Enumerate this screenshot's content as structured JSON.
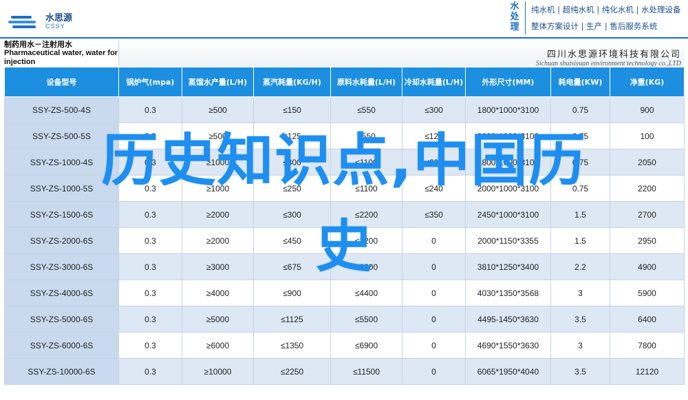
{
  "header": {
    "logo_cn": "水思源",
    "logo_en": "CSSY",
    "slogan_vertical": "水处理",
    "slogan_line1": "纯水机 | 超纯水机 | 纯化水机 | 水处理设备",
    "slogan_line2": "整体方案设计 | 生产 | 售后服务系统"
  },
  "title": {
    "cn": "制药用水－注射用水",
    "en": "Pharmaceutical water, water for injection",
    "company_cn": "四川水思源环境科技有限公司",
    "company_en": "Sichuan shuisiyuan environment technology co.,LTD"
  },
  "table": {
    "columns": [
      "设备型号",
      "锅炉气(mpa)",
      "蒸馏水产量(L/H)",
      "蒸汽耗量(KG/H)",
      "原料水耗量(L/H)",
      "冷却水耗量(L/H)",
      "外形尺寸(MM)",
      "耗电量(KW)",
      "净重(KG)"
    ],
    "rows": [
      [
        "SSY-ZS-500-4S",
        "0.3",
        "≥500",
        "≤150",
        "≤550",
        "≤300",
        "1800*1000*3100",
        "0.75",
        "900"
      ],
      [
        "SSY-ZS-500-5S",
        "0.3",
        "≥500",
        "≤125",
        "≤550",
        "≤120",
        "2000*1000*3100",
        "0.75",
        "100"
      ],
      [
        "SSY-ZS-1000-4S",
        "0.3",
        "≥1000",
        "≤300",
        "≤1100",
        "≤600",
        "1800*1000*3100",
        "0.75",
        "2050"
      ],
      [
        "SSY-ZS-1000-5S",
        "0.3",
        "≥1000",
        "≤250",
        "≤1100",
        "≤240",
        "2000*1000*3100",
        "0.75",
        "2200"
      ],
      [
        "SSY-ZS-1500-6S",
        "0.3",
        "≥2000",
        "≤300",
        "≤2200",
        "≤350",
        "2450*1000*3100",
        "1.5",
        "2700"
      ],
      [
        "SSY-ZS-2000-6S",
        "0.3",
        "≥2000",
        "≤450",
        "≤2200",
        "0",
        "2000*1150*3355",
        "1.5",
        "2950"
      ],
      [
        "SSY-ZS-3000-6S",
        "0.3",
        "≥3000",
        "≤675",
        "≤3300",
        "0",
        "3810*1250*3400",
        "2.2",
        "4900"
      ],
      [
        "SSY-ZS-4000-6S",
        "0.3",
        "≥4000",
        "≤900",
        "≤4400",
        "0",
        "4030*1350*3568",
        "3",
        "5900"
      ],
      [
        "SSY-ZS-5000-6S",
        "0.3",
        "≥5000",
        "≤1125",
        "≤5500",
        "0",
        "4495-1450*3630",
        "3.5",
        "6400"
      ],
      [
        "SSY-ZS-6000-6S",
        "0.3",
        "≥6000",
        "≤1350",
        "≤6900",
        "0",
        "4690*1550*3630",
        "3",
        "7800"
      ],
      [
        "SSY-ZS-10000-6S",
        "0.3",
        "≥10000",
        "≤2250",
        "≤11500",
        "0",
        "6065*1950*4040",
        "3.5",
        "12120"
      ]
    ]
  },
  "overlay": {
    "line1": "历史知识点,中国历",
    "line2": "史"
  }
}
